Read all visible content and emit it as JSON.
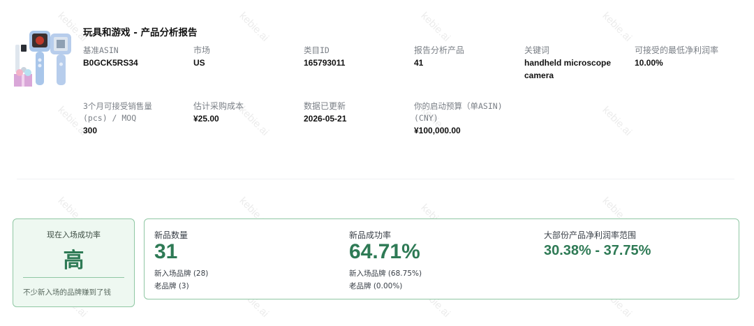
{
  "header": {
    "title": "玩具和游戏 - 产品分析报告"
  },
  "meta_row1": [
    {
      "label": "基准ASIN",
      "value": "B0GCK5RS34"
    },
    {
      "label": "市场",
      "value": "US"
    },
    {
      "label": "类目ID",
      "value": "165793011"
    },
    {
      "label": "报告分析产品",
      "value": "41"
    },
    {
      "label": "关键词",
      "value": "handheld microscope camera"
    },
    {
      "label": "可接受的最低净利润率",
      "value": "10.00%"
    }
  ],
  "meta_row2": [
    {
      "label": "3个月可接受销售量 (pcs) / MOQ",
      "value": "300"
    },
    {
      "label": "估计采购成本",
      "value": "¥25.00"
    },
    {
      "label": "数据已更新",
      "value": "2026-05-21"
    },
    {
      "label": "你的启动预算（单ASIN) (CNY)",
      "value": "¥100,000.00"
    }
  ],
  "rate_card": {
    "title": "现在入场成功率",
    "value": "高",
    "note": "不少新入场的品牌赚到了钱"
  },
  "stats": {
    "new_count": {
      "label": "新品数量",
      "value": "31",
      "sub1": "新入场品牌 (28)",
      "sub2": "老品牌 (3)"
    },
    "success_rate": {
      "label": "新品成功率",
      "value": "64.71%",
      "sub1": "新入场品牌 (68.75%)",
      "sub2": "老品牌 (0.00%)"
    },
    "margin_range": {
      "label": "大部份产品净利润率范围",
      "value": "30.38% - 37.75%"
    }
  },
  "colors": {
    "accent": "#2e7a55",
    "card_border": "#8fc7a3",
    "card_bg": "#eef8f1"
  },
  "watermark": "kebie.ai"
}
